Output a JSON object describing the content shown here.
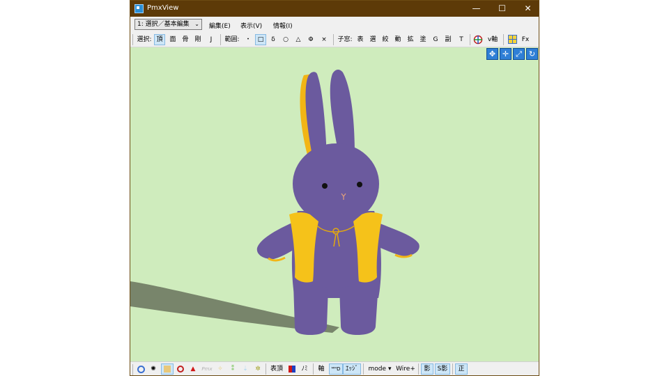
{
  "window": {
    "title": "PmxView",
    "minimize_glyph": "—",
    "maximize_glyph": "☐",
    "close_glyph": "✕"
  },
  "menubar": {
    "mode_combo": "1: 選択／基本編集",
    "combo_arrow": "⌄",
    "menus": [
      "編集(E)",
      "表示(V)",
      "情報(I)"
    ]
  },
  "toolbar": {
    "select_label": "選択:",
    "select_items": [
      "頂",
      "面",
      "骨",
      "剛",
      "J"
    ],
    "range_label": "範囲:",
    "range_items": [
      "・",
      "□",
      "δ",
      "○",
      "△",
      "Φ",
      "×"
    ],
    "child_window_label": "子窓:",
    "child_window_items": [
      "表",
      "選",
      "絞",
      "動",
      "拡",
      "塗",
      "G",
      "副",
      "T"
    ],
    "axis_label": "v軸",
    "fx_label": "Fx"
  },
  "viewport": {
    "background_color": "#cfecbd",
    "nav_icons": [
      "move-arrows-icon",
      "move-cross-icon",
      "zoom-icon",
      "rotate-icon"
    ]
  },
  "statusbar": {
    "items": [
      "表頂",
      "ﾉﾐ",
      "軸",
      "ｴｯｼﾞ",
      "mode",
      "Wire+",
      "影",
      "S影",
      "正"
    ],
    "mode_arrow": "▾",
    "pmx_label": "Pmx"
  },
  "colors": {
    "titlebar": "#5d3a08",
    "rabbit_body": "#6b5a9e",
    "vest": "#f5c21a",
    "shadow": "#6e7a62",
    "accent_active": "#cde6f7"
  }
}
